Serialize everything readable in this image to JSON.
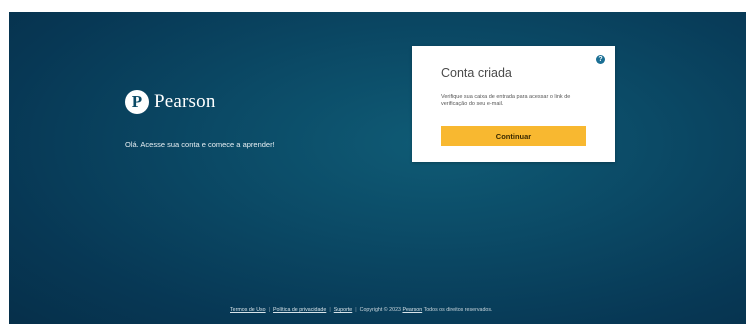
{
  "brand": {
    "logo_letter": "P",
    "name": "Pearson"
  },
  "tagline": "Olá. Acesse sua conta e comece a aprender!",
  "card": {
    "help_icon_glyph": "?",
    "title": "Conta criada",
    "message": "Verifique sua caixa de entrada para acessar o link de verificação do seu e-mail.",
    "continue_label": "Continuar"
  },
  "footer": {
    "links": [
      "Termos de Uso",
      "Política de privacidade",
      "Suporte"
    ],
    "copyright_prefix": "Copyright © 2023",
    "copyright_link": "Pearson",
    "copyright_suffix": "Todos os direitos reservados.",
    "separator": "|"
  },
  "colors": {
    "background": "#0b4a66",
    "button": "#f8b830",
    "help_icon": "#1b6f94"
  },
  "icons": {
    "logo": "pearson-p-logo-icon",
    "help": "help-question-icon"
  }
}
